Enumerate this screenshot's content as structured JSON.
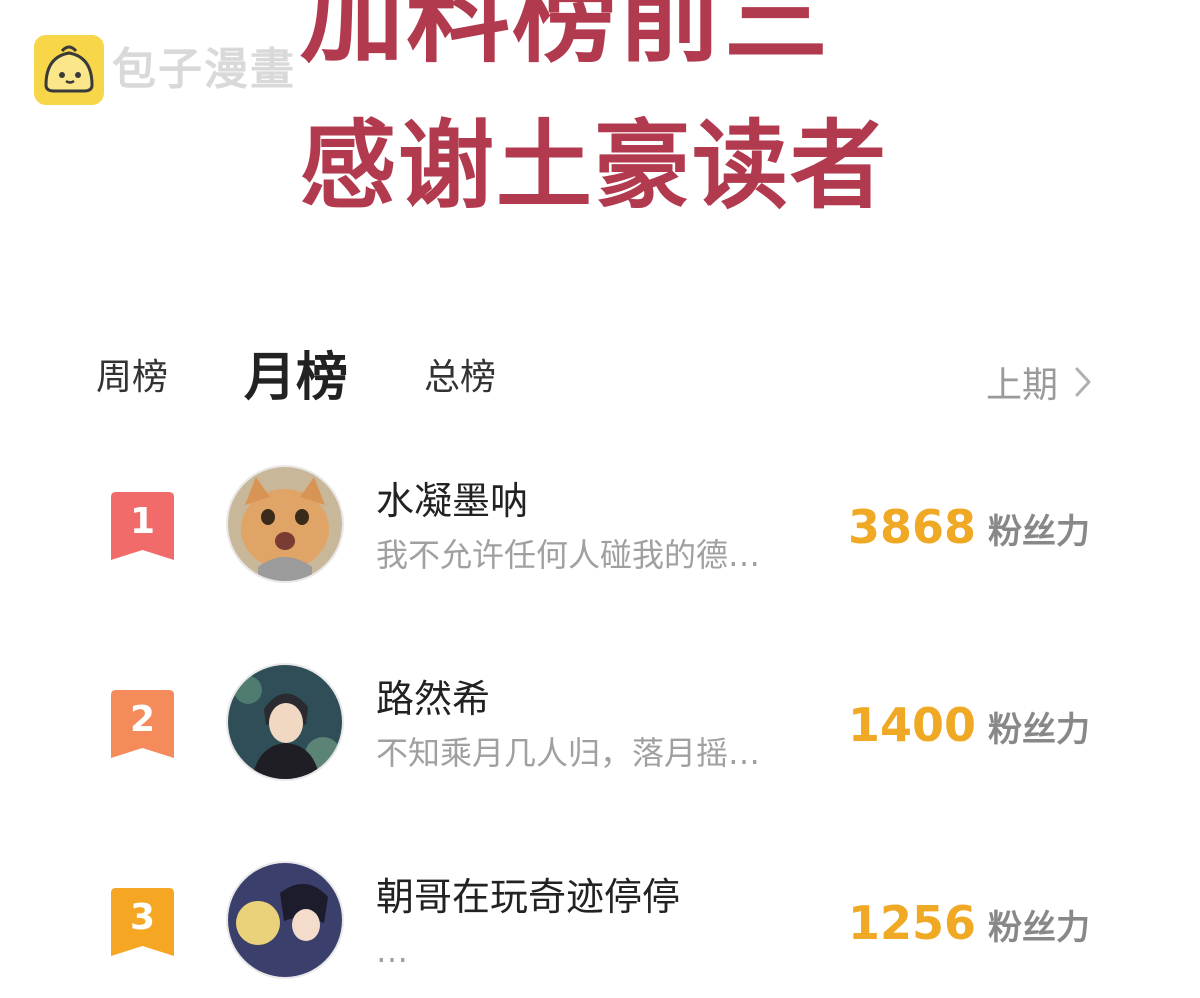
{
  "watermark": {
    "text": "包子漫畫",
    "logo_icon": "baozi-bun-icon"
  },
  "banner": {
    "line1": "加料榜前三",
    "line2": "感谢土豪读者",
    "color": "#b23a4e"
  },
  "tabs": [
    {
      "label": "周榜",
      "active": false
    },
    {
      "label": "月榜",
      "active": true
    },
    {
      "label": "总榜",
      "active": false
    }
  ],
  "prev_period": {
    "label": "上期",
    "icon": "chevron-right-icon"
  },
  "ranking": [
    {
      "rank": "1",
      "name": "水凝墨呐",
      "bio": "我不允许任何人碰我的德…",
      "value": "3868",
      "unit": "粉丝力",
      "badge_color": "#f26b6b"
    },
    {
      "rank": "2",
      "name": "路然希",
      "bio": "不知乘月几人归，落月摇…",
      "value": "1400",
      "unit": "粉丝力",
      "badge_color": "#f58a5a"
    },
    {
      "rank": "3",
      "name": "朝哥在玩奇迹停停",
      "bio": "…",
      "value": "1256",
      "unit": "粉丝力",
      "badge_color": "#f5a623"
    }
  ],
  "colors": {
    "accent": "#f0a925",
    "muted": "#a0a0a0"
  }
}
